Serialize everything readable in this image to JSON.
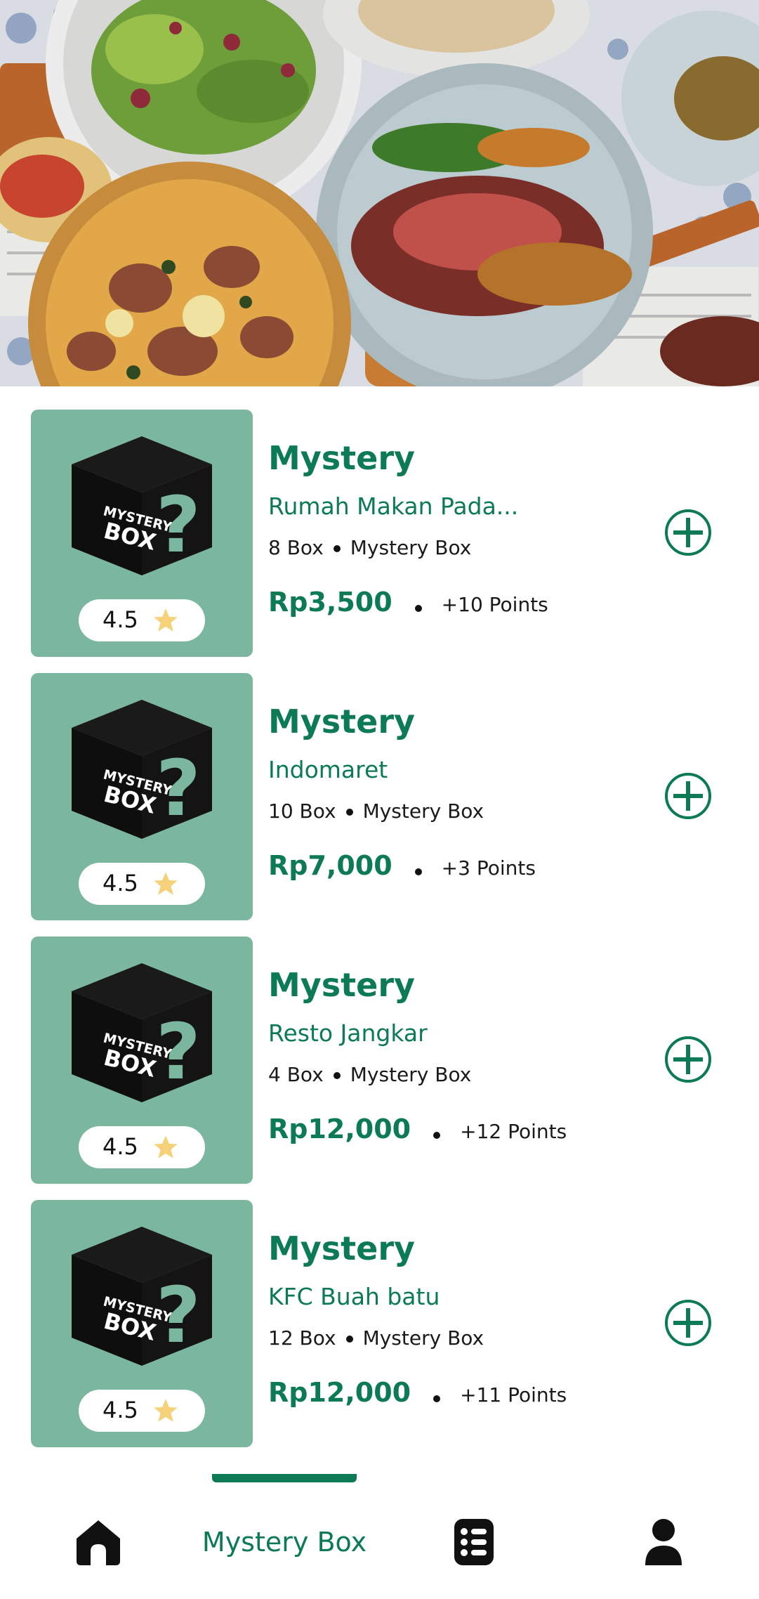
{
  "colors": {
    "brand": "#0b7a55",
    "thumb_bg": "#7bb79f",
    "star": "#f5d27a"
  },
  "items": [
    {
      "title": "Mystery",
      "store": "Rumah Makan Pada...",
      "box_count": "8 Box",
      "category": "Mystery Box",
      "price": "Rp3,500",
      "points": "+10 Points",
      "rating": "4.5"
    },
    {
      "title": "Mystery",
      "store": "Indomaret",
      "box_count": "10 Box",
      "category": "Mystery Box",
      "price": "Rp7,000",
      "points": "+3 Points",
      "rating": "4.5"
    },
    {
      "title": "Mystery",
      "store": "Resto Jangkar",
      "box_count": "4 Box",
      "category": "Mystery Box",
      "price": "Rp12,000",
      "points": "+12 Points",
      "rating": "4.5"
    },
    {
      "title": "Mystery",
      "store": "KFC Buah batu",
      "box_count": "12 Box",
      "category": "Mystery Box",
      "price": "Rp12,000",
      "points": "+11 Points",
      "rating": "4.5"
    }
  ],
  "box_art": {
    "line1": "MYSTERY",
    "line2": "BOX",
    "symbol": "?"
  },
  "nav": {
    "items": [
      {
        "icon": "home-icon",
        "label": ""
      },
      {
        "icon": "",
        "label": "Mystery Box"
      },
      {
        "icon": "list-icon",
        "label": ""
      },
      {
        "icon": "profile-icon",
        "label": ""
      }
    ],
    "active_index": 1
  }
}
